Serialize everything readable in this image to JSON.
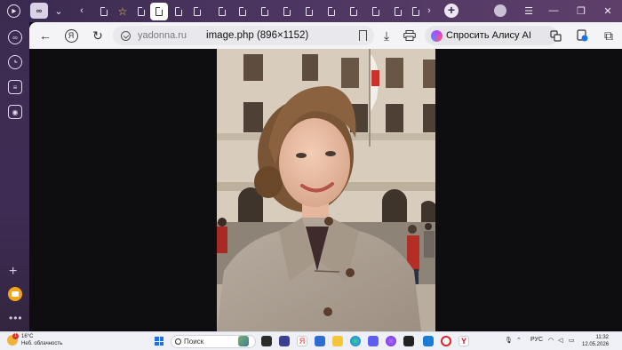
{
  "tabbar": {
    "tab_count": 14,
    "active_tab_index": 4
  },
  "addressbar": {
    "domain": "yadonna.ru",
    "page_title": "image.php (896×1152)",
    "alice_label": "Спросить Алису AI"
  },
  "taskbar": {
    "temperature": "16°C",
    "weather_text": "Неб. облачность",
    "weather_badge": "1",
    "search_placeholder": "Поиск",
    "language": "РУС",
    "time": "11:32",
    "date": "12.05.2026"
  },
  "colors": {
    "tabbar_bg": "#4a3560",
    "sidebar_bg": "#3d2c52",
    "addressbar_bg": "#f4f4f6",
    "content_bg": "#0e0e10",
    "taskbar_bg": "#eef0f6"
  },
  "icons": {
    "sidebar": [
      "collections-icon",
      "history-icon",
      "notes-icon",
      "screenshot-icon",
      "add-icon",
      "mail-icon",
      "more-icon"
    ],
    "addressbar": [
      "back-arrow-icon",
      "yandex-icon",
      "refresh-icon",
      "lock-icon",
      "bookmark-icon",
      "download-icon",
      "print-icon",
      "alice-icon",
      "translate-icon",
      "shield-icon",
      "extensions-icon"
    ]
  }
}
